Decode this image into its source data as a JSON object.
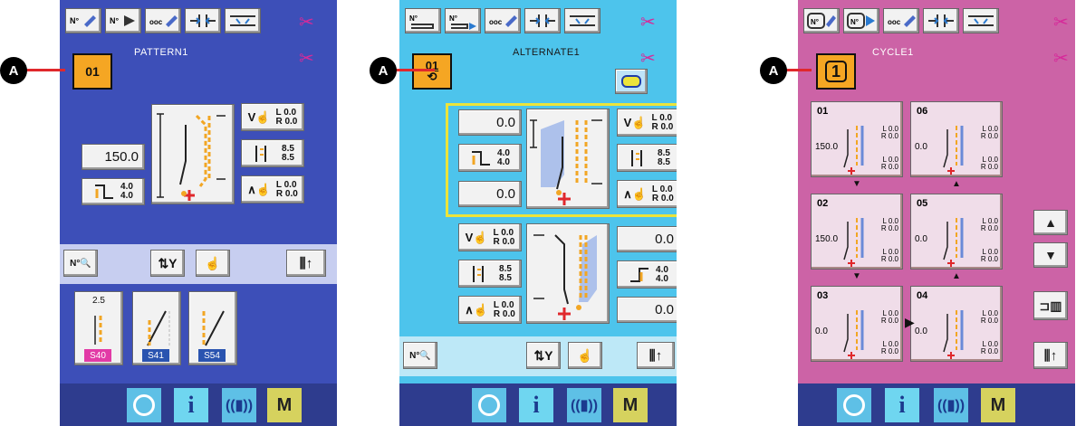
{
  "marker_label": "A",
  "panels": [
    {
      "title": "PATTERN1",
      "number": "01",
      "left_value": "150.0",
      "feed_value_top": "4.0",
      "feed_value_bottom": "4.0",
      "right_values": [
        {
          "top": "0.0",
          "bottom": "0.0",
          "letters": "L R"
        },
        {
          "top": "8.5",
          "bottom": "8.5",
          "letters": ""
        },
        {
          "top": "0.0",
          "bottom": "0.0",
          "letters": "L R"
        }
      ],
      "stitch_number": "2.5",
      "patterns": [
        "S40",
        "S41",
        "S54"
      ],
      "pattern_colors": [
        "#e23aa6",
        "#2a54b0",
        "#2a54b0"
      ]
    },
    {
      "title": "ALTERNATE1",
      "number": "01",
      "values_left_top": "0.0",
      "values_left_bottom": "0.0",
      "feed_top": "4.0",
      "feed_bottom": "4.0",
      "right_values_top": [
        {
          "top": "0.0",
          "bottom": "0.0"
        },
        {
          "top": "8.5",
          "bottom": "8.5"
        },
        {
          "top": "0.0",
          "bottom": "0.0"
        }
      ],
      "lower_left_values": [
        {
          "top": "0.0",
          "bottom": "0.0"
        },
        {
          "top": "8.5",
          "bottom": "8.5"
        },
        {
          "top": "0.0",
          "bottom": "0.0"
        }
      ],
      "lower_right_top": "0.0",
      "lower_feed_top": "4.0",
      "lower_feed_bottom": "4.0",
      "lower_right_bottom": "0.0"
    },
    {
      "title": "CYCLE1",
      "number": "1",
      "cards": [
        {
          "step": "01",
          "left": "150.0",
          "vals": [
            "0.0",
            "0.0",
            "0.0",
            "0.0"
          ]
        },
        {
          "step": "06",
          "left": "0.0",
          "vals": [
            "0.0",
            "0.0",
            "0.0",
            "0.0"
          ]
        },
        {
          "step": "02",
          "left": "150.0",
          "vals": [
            "0.0",
            "0.0",
            "0.0",
            "0.0"
          ]
        },
        {
          "step": "05",
          "left": "0.0",
          "vals": [
            "0.0",
            "0.0",
            "0.0",
            "0.0"
          ]
        },
        {
          "step": "03",
          "left": "0.0",
          "vals": [
            "0.0",
            "0.0",
            "0.0",
            "0.0"
          ]
        },
        {
          "step": "04",
          "left": "0.0",
          "vals": [
            "0.0",
            "0.0",
            "0.0",
            "0.0"
          ]
        }
      ]
    }
  ],
  "top_icons": [
    "No.",
    "No.",
    "ABC",
    "",
    ""
  ],
  "bottom_bar": [
    "ready-icon",
    "info-icon",
    "communication-icon",
    "M"
  ],
  "colors": {
    "panel1": "#3d4fb8",
    "panel2": "#4dc4ec",
    "panel3": "#cc63a6",
    "selected": "#f5a623",
    "marker": "#e0282c"
  }
}
